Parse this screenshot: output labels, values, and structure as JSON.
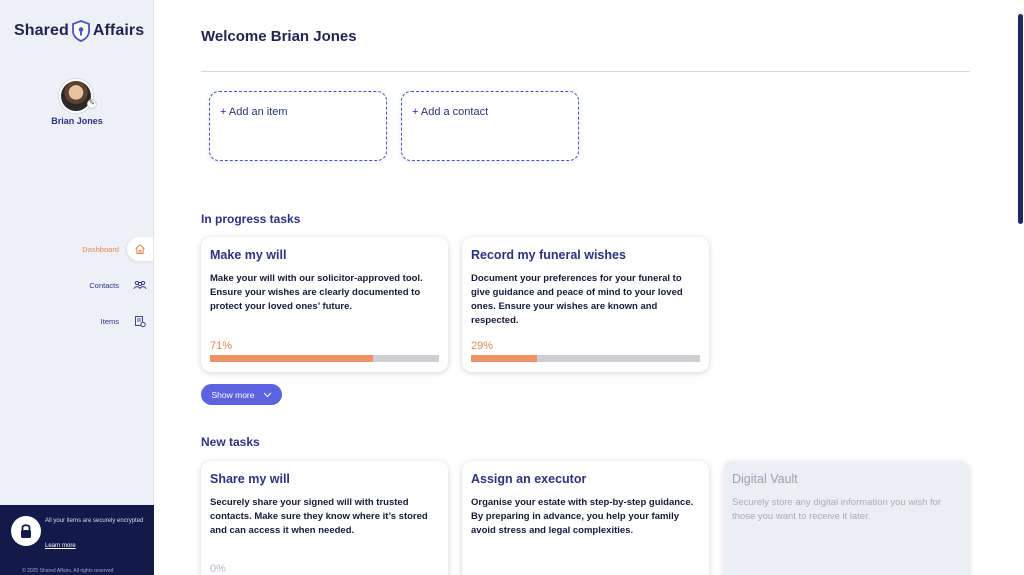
{
  "app": {
    "logo_left": "Shared",
    "logo_right": "Affairs"
  },
  "user": {
    "name": "Brian Jones"
  },
  "sidebar": {
    "items": [
      {
        "label": "Dashboard",
        "icon": "home-icon",
        "active": true
      },
      {
        "label": "Contacts",
        "icon": "contacts-icon",
        "active": false
      },
      {
        "label": "Items",
        "icon": "items-icon",
        "active": false
      }
    ],
    "footer": {
      "encrypted_text": "All your items are securely encrypted",
      "learn_more": "Learn more",
      "copyright": "© 2025 Shared Affairs. All rights reserved"
    }
  },
  "main": {
    "welcome": "Welcome Brian Jones",
    "add_item": "+ Add an item",
    "add_contact": "+ Add a contact",
    "in_progress_title": "In progress tasks",
    "in_progress": [
      {
        "title": "Make my will",
        "description": "Make your will with our solicitor-approved tool. Ensure your wishes are clearly documented to protect your loved ones’ future.",
        "progress_label": "71%",
        "progress": 0.71
      },
      {
        "title": "Record my funeral wishes",
        "description": "Document your preferences for your funeral to give guidance and peace of mind to your loved ones. Ensure your wishes are known and respected.",
        "progress_label": "29%",
        "progress": 0.29
      }
    ],
    "show_more": "Show more",
    "new_tasks_title": "New tasks",
    "new_tasks": [
      {
        "title": "Share my will",
        "description": "Securely share your signed will with trusted contacts. Make sure they know where it’s stored and can access it when needed.",
        "progress_label": "0%"
      },
      {
        "title": "Assign an executor",
        "description": "Organise your estate with step-by-step guidance. By preparing in advance, you help your family avoid stress and legal complexities."
      },
      {
        "title": "Digital Vault",
        "description": "Securely store any digital information you wish for those you want to receive it later."
      }
    ]
  },
  "colors": {
    "accent": "#5b63e0",
    "navy": "#131a4a",
    "progress": "#ec9466",
    "active_nav": "#e8855a"
  }
}
